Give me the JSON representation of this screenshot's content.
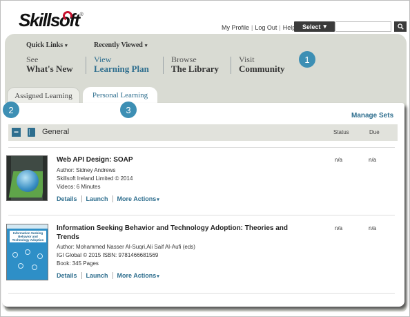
{
  "brand": {
    "logo_text": "Skillsoft",
    "trademark": "®"
  },
  "toplinks": [
    {
      "label": "My Profile"
    },
    {
      "label": "Log Out"
    },
    {
      "label": "Help"
    }
  ],
  "select": {
    "label": "Select",
    "caret": "▾"
  },
  "search": {
    "value": "",
    "placeholder": ""
  },
  "quick": {
    "quick_links": "Quick Links",
    "recently_viewed": "Recently Viewed",
    "caret": "▾"
  },
  "nav": [
    {
      "line1": "See",
      "line2": "What's New"
    },
    {
      "line1": "View",
      "line2": "Learning Plan"
    },
    {
      "line1": "Browse",
      "line2": "The Library"
    },
    {
      "line1": "Visit",
      "line2": "Community"
    }
  ],
  "badges": [
    "1",
    "2",
    "3"
  ],
  "tabs": [
    {
      "label": "Assigned Learning"
    },
    {
      "label": "Personal Learning"
    }
  ],
  "panel": {
    "manage_sets": "Manage Sets",
    "group": {
      "collapse_symbol": "−",
      "name": "General",
      "col_status": "Status",
      "col_due": "Due"
    }
  },
  "items": [
    {
      "title": "Web API Design: SOAP",
      "author": "Author: Sidney Andrews",
      "publisher": "Skillsoft Ireland Limited © 2014",
      "length": "Videos: 6 Minutes",
      "status": "n/a",
      "due": "n/a",
      "actions": {
        "details": "Details",
        "launch": "Launch",
        "more": "More Actions"
      }
    },
    {
      "title": "Information Seeking Behavior and Technology Adoption: Theories and Trends",
      "author": "Author: Mohammed Nasser Al-Suqri,Ali Saif Al-Aufi (eds)",
      "publisher": "IGI Global © 2015 ISBN: 9781466681569",
      "length": "Book: 345 Pages",
      "status": "n/a",
      "due": "n/a",
      "actions": {
        "details": "Details",
        "launch": "Launch",
        "more": "More Actions"
      }
    }
  ],
  "book_cover_text": "Information Seeking Behavior and Technology Adoption",
  "colors": {
    "accent": "#2e6e8e",
    "badge": "#3d8fb4",
    "band": "#d9dbd3"
  }
}
